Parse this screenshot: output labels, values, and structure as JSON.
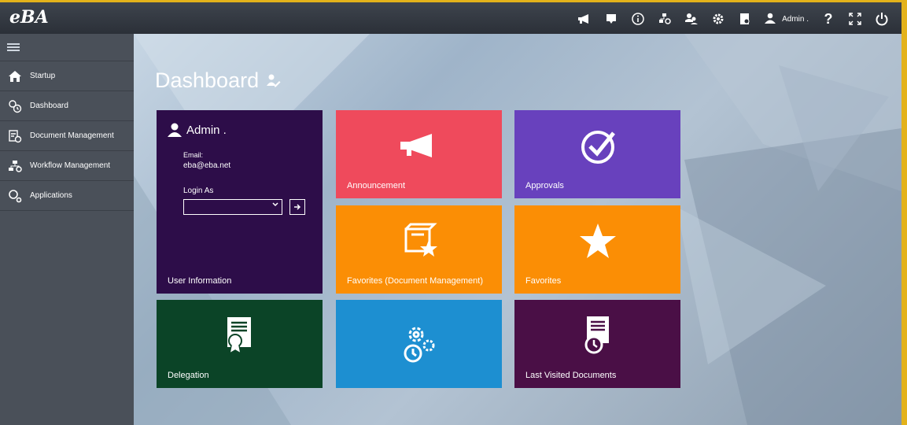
{
  "app": {
    "logo": "eBA"
  },
  "topbar": {
    "icons": [
      "megaphone-icon",
      "message-icon",
      "info-icon",
      "workflow-icon",
      "users-icon",
      "gear-icon",
      "document-icon"
    ],
    "user_label": "Admin .",
    "help_icon": "?"
  },
  "sidebar": {
    "items": [
      {
        "label": "Startup",
        "icon": "home-icon"
      },
      {
        "label": "Dashboard",
        "icon": "dashboard-icon"
      },
      {
        "label": "Document Management",
        "icon": "document-management-icon"
      },
      {
        "label": "Workflow Management",
        "icon": "workflow-management-icon"
      },
      {
        "label": "Applications",
        "icon": "applications-icon"
      }
    ]
  },
  "main": {
    "title": "Dashboard",
    "user_card": {
      "name": "Admin .",
      "email_label": "Email:",
      "email": "eba@eba.net",
      "login_as_label": "Login As",
      "label": "User Information"
    },
    "tiles": {
      "announcement": "Announcement",
      "approvals": "Approvals",
      "favorites_dm": "Favorites (Document Management)",
      "favorites": "Favorites",
      "delegation": "Delegation",
      "last_visited": "Last Visited Documents"
    }
  },
  "colors": {
    "user_info": "#2d0d49",
    "announcement": "#ef4a5c",
    "approvals": "#6841bd",
    "favorites": "#fb8e05",
    "delegation": "#0b4427",
    "workflow": "#1d8fd1",
    "last_visited": "#4a0f46"
  }
}
